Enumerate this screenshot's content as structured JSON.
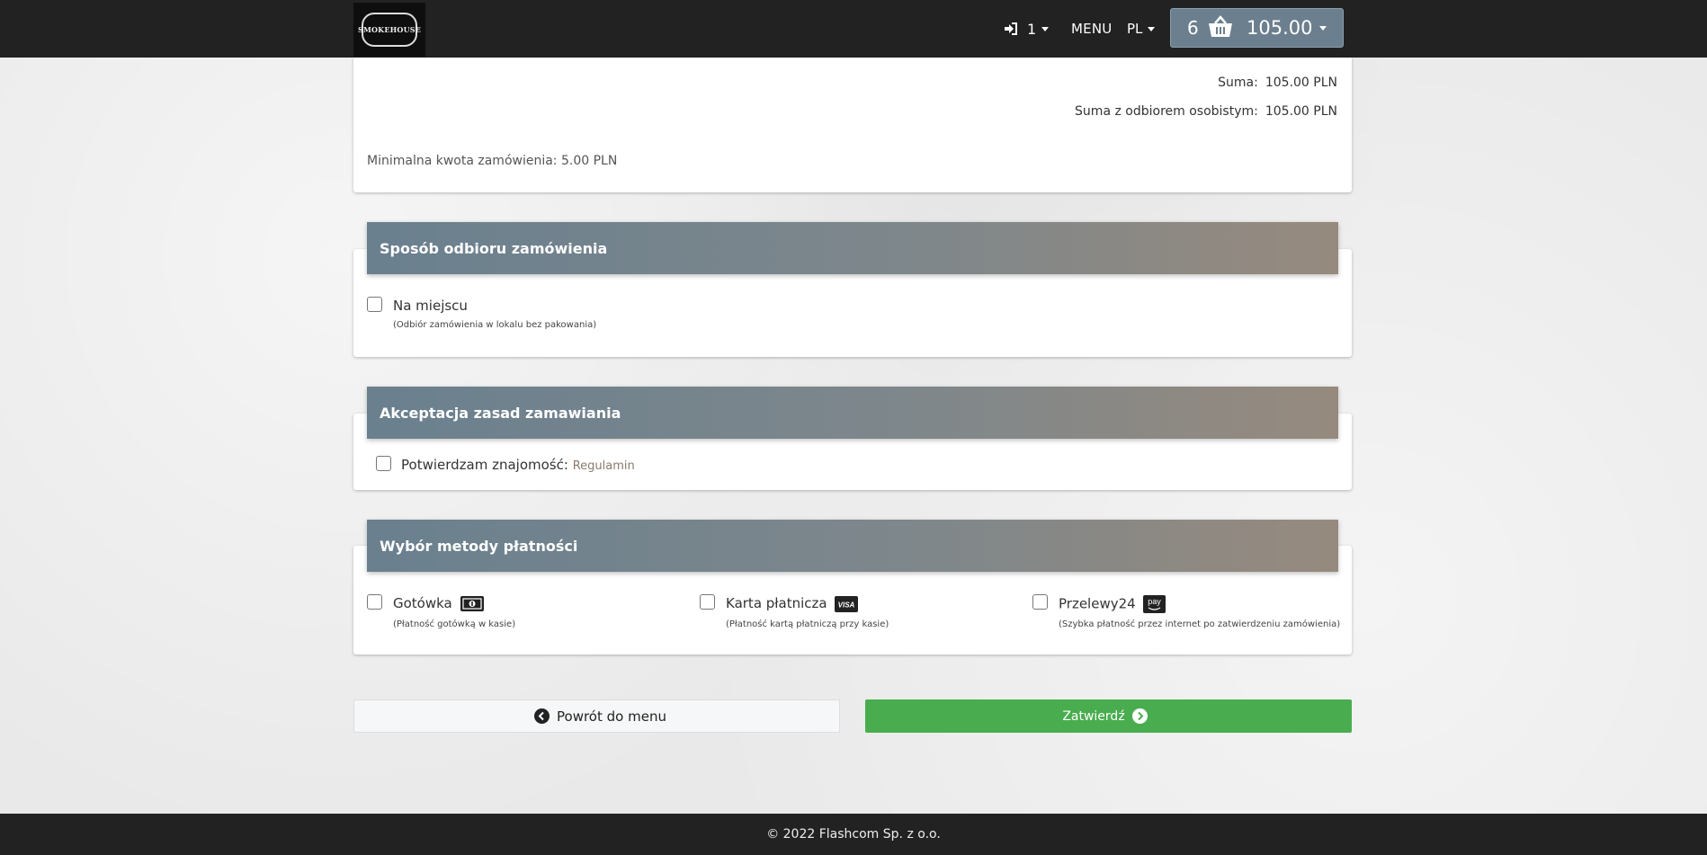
{
  "nav": {
    "logo_text": "SMOKEHOUSE",
    "login_count": "1",
    "menu_label": "MENU",
    "lang_label": "PL"
  },
  "cart": {
    "count": "6",
    "total": "105.00"
  },
  "summary": {
    "sum_label": "Suma:",
    "sum_value": "105.00 PLN",
    "pickup_label": "Suma z odbiorem osobistym:",
    "pickup_value": "105.00 PLN",
    "minimal_text": "Minimalna kwota zamówienia: 5.00 PLN"
  },
  "pickup_section": {
    "title": "Sposób odbioru zamówienia",
    "option_label": "Na miejscu",
    "option_desc": "(Odbiór zamówienia w lokalu bez pakowania)"
  },
  "terms_section": {
    "title": "Akceptacja zasad zamawiania",
    "confirm_label": "Potwierdzam znajomość:",
    "link_text": "Regulamin"
  },
  "payment_section": {
    "title": "Wybór metody płatności",
    "methods": [
      {
        "label": "Gotówka",
        "desc": "(Płatność gotówką w kasie)",
        "icon": "cash-icon"
      },
      {
        "label": "Karta płatnicza",
        "desc": "(Płatność kartą płatniczą przy kasie)",
        "icon": "visa-icon",
        "badge": "VISA"
      },
      {
        "label": "Przelewy24",
        "desc": "(Szybka płatność przez internet po zatwierdzeniu zamówienia)",
        "icon": "pay-icon",
        "badge": "pay"
      }
    ]
  },
  "buttons": {
    "back_label": "Powrót do menu",
    "confirm_label": "Zatwierdź"
  },
  "footer": {
    "text": "© 2022 Flashcom Sp. z o.o."
  },
  "colors": {
    "navbar": "#222222",
    "cart_button": "#6c7f8e",
    "header_gradient_start": "#6a808f",
    "header_gradient_end": "#968a7e",
    "confirm_button": "#49ad4f",
    "link": "#8a7b6b"
  }
}
